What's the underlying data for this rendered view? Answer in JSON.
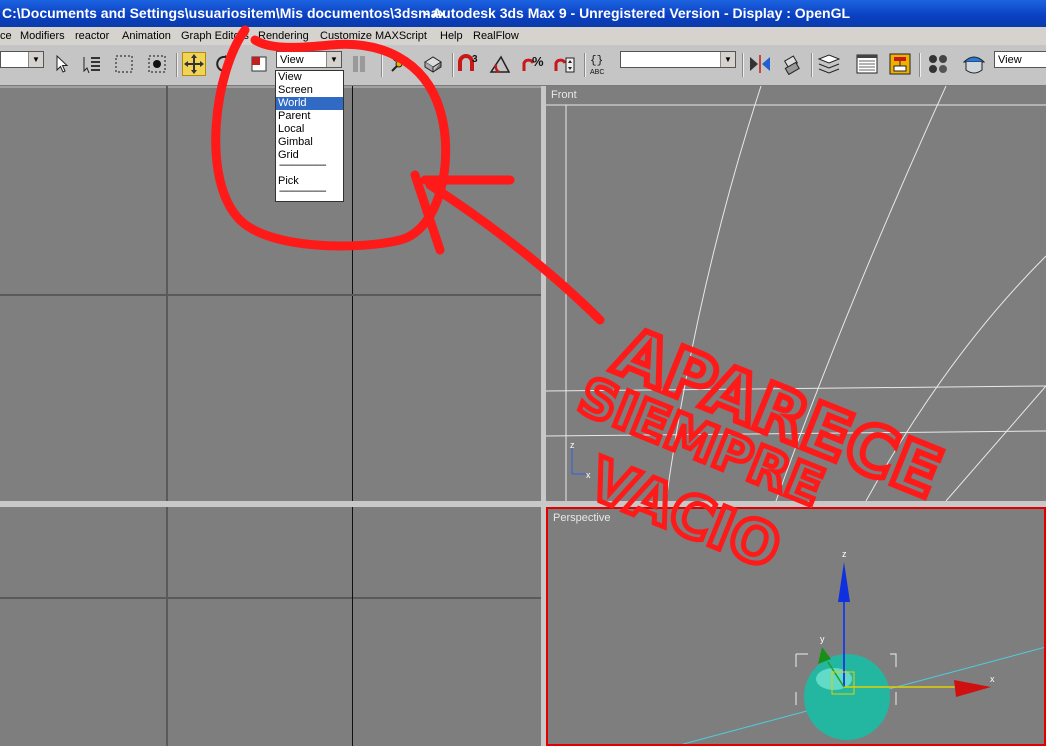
{
  "window": {
    "path": "C:\\Documents and Settings\\usuariositem\\Mis documentos\\3dsmax",
    "app_title": "- Autodesk 3ds Max 9  - Unregistered Version",
    "display": "- Display : OpenGL"
  },
  "menu": [
    "ce",
    "Modifiers",
    "reactor",
    "Animation",
    "Graph Editors",
    "Rendering",
    "Customize",
    "MAXScript",
    "Help",
    "RealFlow"
  ],
  "toolbar": {
    "selection_set_value": "",
    "reference_coord_value": "View",
    "named_selection_value": "",
    "view_box_value": "View",
    "icons": [
      "select-object-icon",
      "select-by-name-icon",
      "rectangular-selection-icon",
      "window-crossing-icon",
      "select-and-move-icon",
      "select-and-rotate-icon",
      "select-and-scale-icon",
      "use-pivot-center-icon",
      "select-and-manipulate-icon",
      "keyboard-shortcut-override-icon",
      "snaps-toggle-icon",
      "angle-snap-icon",
      "percent-snap-icon",
      "spinner-snap-icon",
      "edit-named-selection-icon",
      "mirror-icon",
      "align-icon",
      "layer-manager-icon",
      "curve-editor-icon",
      "schematic-view-icon",
      "material-editor-icon",
      "render-scene-icon"
    ]
  },
  "coord_dropdown": {
    "options": [
      "View",
      "Screen",
      "World",
      "Parent",
      "Local",
      "Gimbal",
      "Grid"
    ],
    "separator": "--------------------",
    "pick": "Pick",
    "selected": "World"
  },
  "viewports": {
    "front_label": "Front",
    "perspective_label": "Perspective"
  },
  "annotation": {
    "line1": "APARECE",
    "line2": "SIEMPRE",
    "line3": "VACIO",
    "color": "#ff1a1a"
  },
  "colors": {
    "title_bar": "#0a3fc2",
    "active_viewport_border": "#e00000",
    "sphere": "#22b9a4",
    "gizmo_z": "#1030e0",
    "gizmo_x": "#d01010",
    "gizmo_y": "#20a020"
  }
}
